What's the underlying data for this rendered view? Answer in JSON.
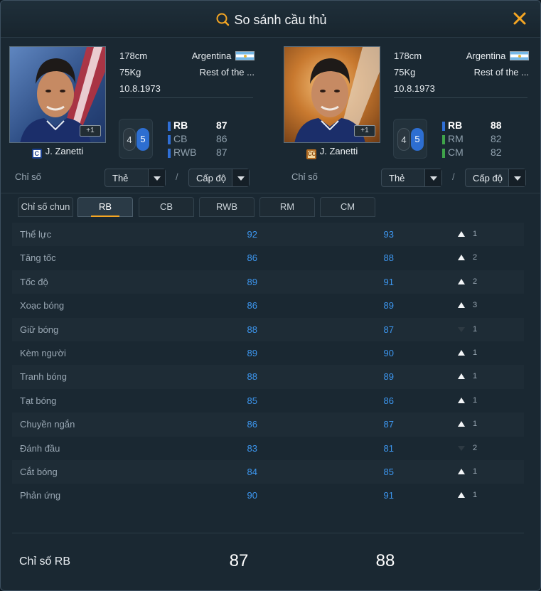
{
  "title": "So sánh cầu thủ",
  "colors": {
    "accent": "#f5a623",
    "stat_blue": "#3d97f0",
    "background": "#1a2832"
  },
  "players": [
    {
      "height": "178cm",
      "nationality": "Argentina",
      "weight": "75Kg",
      "club": "Rest of the ...",
      "birthdate": "10.8.1973",
      "plus": "+1",
      "card_badge": "C",
      "name": "J. Zanetti",
      "foot_left": "4",
      "foot_right": "5",
      "positions": [
        {
          "pos": "RB",
          "val": "87",
          "color": "#2f6fd6"
        },
        {
          "pos": "CB",
          "val": "86",
          "color": "#2f6fd6"
        },
        {
          "pos": "RWB",
          "val": "87",
          "color": "#2f6fd6"
        }
      ],
      "filter_label": "Chỉ số",
      "dropdown_card": "Thẻ",
      "dropdown_level": "Cấp độ"
    },
    {
      "height": "178cm",
      "nationality": "Argentina",
      "weight": "75Kg",
      "club": "Rest of the ...",
      "birthdate": "10.8.1973",
      "plus": "+1",
      "card_badge": "CC",
      "name": "J. Zanetti",
      "foot_left": "4",
      "foot_right": "5",
      "positions": [
        {
          "pos": "RB",
          "val": "88",
          "color": "#2f6fd6"
        },
        {
          "pos": "RM",
          "val": "82",
          "color": "#3fa34a"
        },
        {
          "pos": "CM",
          "val": "82",
          "color": "#3fa34a"
        }
      ],
      "filter_label": "Chỉ số",
      "dropdown_card": "Thẻ",
      "dropdown_level": "Cấp độ"
    }
  ],
  "tabs": [
    "Chỉ số chun",
    "RB",
    "CB",
    "RWB",
    "RM",
    "CM"
  ],
  "active_tab": 1,
  "stats": [
    {
      "name": "Thể lực",
      "p1": "92",
      "p2": "93",
      "dir": "up",
      "diff": "1"
    },
    {
      "name": "Tăng tốc",
      "p1": "86",
      "p2": "88",
      "dir": "up",
      "diff": "2"
    },
    {
      "name": "Tốc độ",
      "p1": "89",
      "p2": "91",
      "dir": "up",
      "diff": "2"
    },
    {
      "name": "Xoạc bóng",
      "p1": "86",
      "p2": "89",
      "dir": "up",
      "diff": "3"
    },
    {
      "name": "Giữ bóng",
      "p1": "88",
      "p2": "87",
      "dir": "down",
      "diff": "1"
    },
    {
      "name": "Kèm người",
      "p1": "89",
      "p2": "90",
      "dir": "up",
      "diff": "1"
    },
    {
      "name": "Tranh bóng",
      "p1": "88",
      "p2": "89",
      "dir": "up",
      "diff": "1"
    },
    {
      "name": "Tạt bóng",
      "p1": "85",
      "p2": "86",
      "dir": "up",
      "diff": "1"
    },
    {
      "name": "Chuyền ngắn",
      "p1": "86",
      "p2": "87",
      "dir": "up",
      "diff": "1"
    },
    {
      "name": "Đánh đầu",
      "p1": "83",
      "p2": "81",
      "dir": "down",
      "diff": "2"
    },
    {
      "name": "Cắt bóng",
      "p1": "84",
      "p2": "85",
      "dir": "up",
      "diff": "1"
    },
    {
      "name": "Phản ứng",
      "p1": "90",
      "p2": "91",
      "dir": "up",
      "diff": "1"
    }
  ],
  "summary": {
    "label": "Chỉ số RB",
    "p1": "87",
    "p2": "88"
  }
}
